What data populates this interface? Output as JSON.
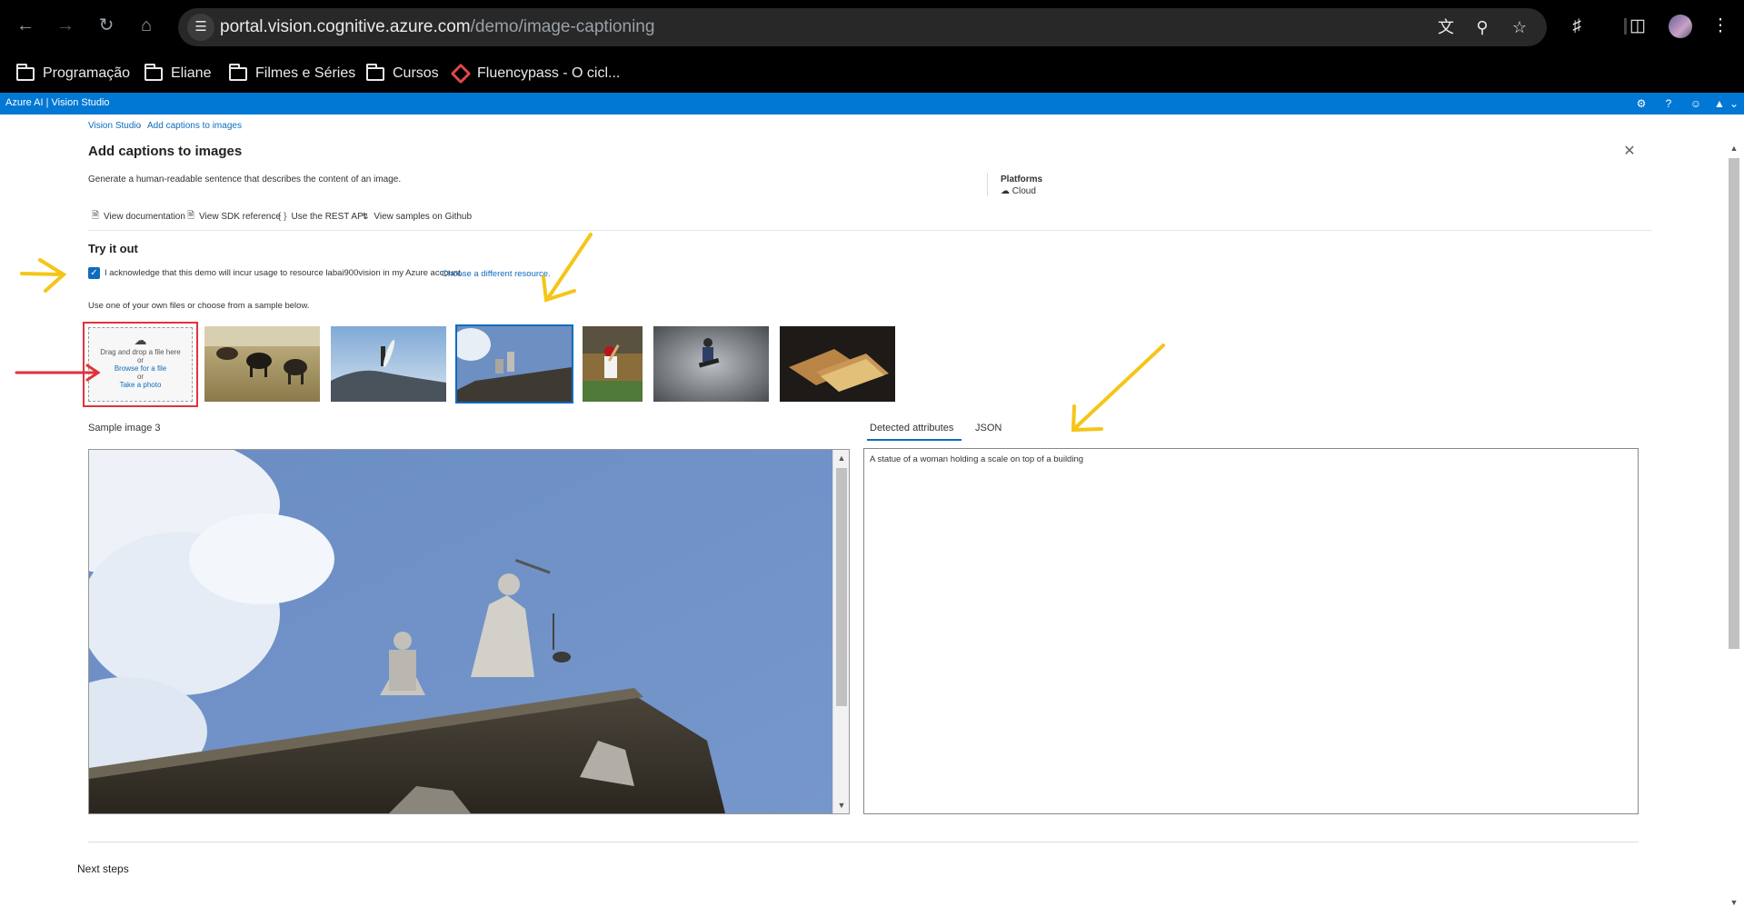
{
  "browser": {
    "url_host": "portal.vision.cognitive.azure.com",
    "url_path": "/demo/image-captioning",
    "bookmarks": [
      {
        "label": "Programação",
        "icon": "folder-icon"
      },
      {
        "label": "Eliane",
        "icon": "folder-icon"
      },
      {
        "label": "Filmes e Séries",
        "icon": "folder-icon"
      },
      {
        "label": "Cursos",
        "icon": "folder-icon"
      },
      {
        "label": "Fluencypass - O cicl...",
        "icon": "fluencypass-icon"
      }
    ]
  },
  "azure_bar": {
    "title": "Azure AI  |  Vision Studio"
  },
  "breadcrumb": {
    "root": "Vision Studio",
    "current": "Add captions to images"
  },
  "page": {
    "title": "Add captions to images",
    "description": "Generate a human-readable sentence that describes the content of an image.",
    "platforms_label": "Platforms",
    "platforms_value": "Cloud",
    "links": [
      "View documentation",
      "View SDK reference",
      "Use the REST API",
      "View samples on Github"
    ]
  },
  "try_it": {
    "title": "Try it out",
    "acknowledge_text": "I acknowledge that this demo will incur usage to resource labai900vision in my Azure account.",
    "acknowledge_checked": true,
    "choose_resource_link": "Choose a different resource.",
    "use_text": "Use one of your own files or choose from a sample below.",
    "upload": {
      "drag_text": "Drag and drop a file here",
      "or1": "or",
      "browse": "Browse for a file",
      "or2": "or",
      "take_photo": "Take a photo"
    },
    "selected_sample_index": 2
  },
  "preview": {
    "label": "Sample image 3"
  },
  "result": {
    "tabs": [
      "Detected attributes",
      "JSON"
    ],
    "active_tab": "Detected attributes",
    "caption": "A statue of a woman holding a scale on top of a building"
  },
  "footer": {
    "next_steps": "Next steps"
  },
  "colors": {
    "azure_blue": "#0078d4",
    "link_blue": "#0f6cbd",
    "annotation_yellow": "#f5c518",
    "annotation_red": "#e0323c"
  }
}
